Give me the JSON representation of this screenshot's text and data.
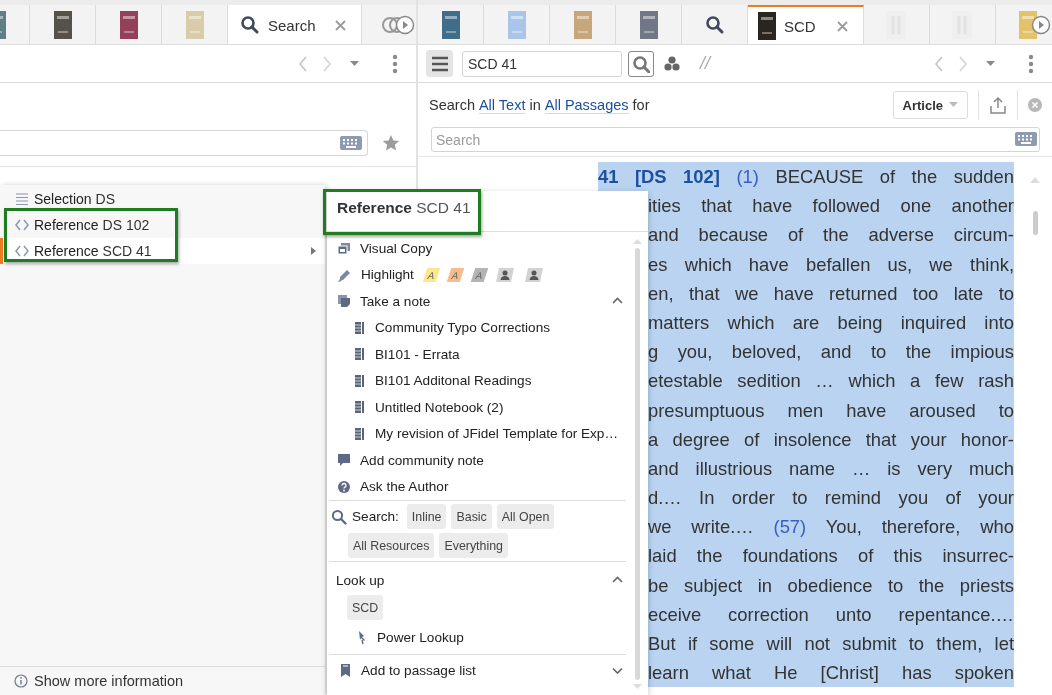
{
  "left_pane": {
    "focused": false,
    "tabs": [
      {
        "kind": "book",
        "color": "#5f7f86",
        "selected": false
      },
      {
        "kind": "book",
        "color": "#57514b",
        "selected": false
      },
      {
        "kind": "book",
        "color": "#94405a",
        "selected": false
      },
      {
        "kind": "book",
        "color": "#d9ccaa",
        "selected": false
      },
      {
        "kind": "search",
        "label": "Search",
        "selected": true
      },
      {
        "kind": "app",
        "selected": false
      }
    ],
    "context_menu": {
      "items": [
        {
          "kind": "selection",
          "label": "Selection",
          "detail": "DS",
          "selected": false,
          "submenu": false,
          "annotated": false
        },
        {
          "kind": "reference",
          "label": "Reference",
          "detail": "DS 102",
          "selected": false,
          "submenu": false,
          "annotated": true
        },
        {
          "kind": "reference",
          "label": "Reference",
          "detail": "SCD 41",
          "selected": true,
          "submenu": true,
          "annotated": true
        }
      ],
      "footer": "Show more information"
    }
  },
  "right_pane": {
    "focused": true,
    "tabs": [
      {
        "kind": "book",
        "color": "#3f6d8a",
        "selected": false
      },
      {
        "kind": "book",
        "color": "#a9c6ea",
        "selected": false
      },
      {
        "kind": "book",
        "color": "#c6a67a",
        "selected": false
      },
      {
        "kind": "book",
        "color": "#717784",
        "selected": false
      },
      {
        "kind": "search",
        "selected": false
      },
      {
        "kind": "book",
        "color": "#2b2520",
        "label": "SCD",
        "selected": true
      },
      {
        "kind": "placeholder_book",
        "selected": false
      },
      {
        "kind": "placeholder_book",
        "selected": false
      },
      {
        "kind": "book",
        "color": "#e2c36c",
        "selected": false
      }
    ],
    "toolbar": {
      "reference": "SCD 41",
      "parallel": "//"
    },
    "search_bar": {
      "query": [
        {
          "kind": "text",
          "text": "Search"
        },
        {
          "kind": "link",
          "text": "All Text"
        },
        {
          "kind": "text",
          "text": "in"
        },
        {
          "kind": "link",
          "text": "All Passages"
        },
        {
          "kind": "text",
          "text": "for"
        }
      ],
      "type_button": "Article",
      "placeholder": "Search"
    },
    "document": {
      "lines": [
        [
          {
            "kind": "ref",
            "text": "41 [DS 102]"
          },
          {
            "kind": "num",
            "text": "(1)"
          },
          {
            "kind": "text",
            "text": "BECAUSE of the sudden"
          }
        ],
        [
          {
            "kind": "text",
            "text": "ities that have followed one another"
          }
        ],
        [
          {
            "kind": "text",
            "text": "and because of the adverse circum-"
          }
        ],
        [
          {
            "kind": "text",
            "text": "es which have befallen us, we think,"
          }
        ],
        [
          {
            "kind": "text",
            "text": "en, that we have returned too late to"
          }
        ],
        [
          {
            "kind": "text",
            "text": "matters which are being inquired into"
          }
        ],
        [
          {
            "kind": "text",
            "text": "g you, beloved, and to the impious"
          }
        ],
        [
          {
            "kind": "text",
            "text": "etestable sedition … which a few rash"
          }
        ],
        [
          {
            "kind": "text",
            "text": "presumptuous men have aroused to"
          }
        ],
        [
          {
            "kind": "text",
            "text": "a degree of insolence that your honor-"
          }
        ],
        [
          {
            "kind": "text",
            "text": "and illustrious name … is very much"
          }
        ],
        [
          {
            "kind": "text",
            "text": "d.… In order to remind you of your"
          }
        ],
        [
          {
            "kind": "text",
            "text": "we write.…"
          },
          {
            "kind": "num",
            "text": "(57)"
          },
          {
            "kind": "text",
            "text": "You, therefore, who"
          }
        ],
        [
          {
            "kind": "text",
            "text": "laid the foundations of this insurrec-"
          }
        ],
        [
          {
            "kind": "text",
            "text": "be subject in obedience to the priests"
          }
        ],
        [
          {
            "kind": "text",
            "text": "eceive correction unto repentance.…"
          }
        ],
        [
          {
            "kind": "text",
            "text": "But if some will not submit to them, let"
          }
        ],
        [
          {
            "kind": "text",
            "text": "learn what He [Christ] has spoken"
          }
        ]
      ]
    }
  },
  "popup": {
    "title": "Reference",
    "title_detail": "SCD 41",
    "annotated": true,
    "items": [
      {
        "kind": "visual_copy",
        "label": "Visual Copy"
      },
      {
        "kind": "highlight",
        "label": "Highlight",
        "swatches": [
          {
            "kind": "letter",
            "text": "A",
            "color": "#fde68c"
          },
          {
            "kind": "letter",
            "text": "A",
            "color": "#f8bc8c"
          },
          {
            "kind": "letter",
            "text": "A",
            "color": "#b4b4b4"
          },
          {
            "kind": "person",
            "color": "#d2d2d2"
          },
          {
            "kind": "person",
            "color": "#d2d2d2"
          }
        ]
      },
      {
        "kind": "note",
        "label": "Take a note",
        "expanded": true,
        "children": [
          {
            "label": "Community Typo Corrections"
          },
          {
            "label": "BI101 - Errata"
          },
          {
            "label": "BI101 Additonal Readings"
          },
          {
            "label": "Untitled Notebook (2)"
          },
          {
            "label": "My revision of JFidel Template for Exp…"
          }
        ]
      },
      {
        "kind": "community_note",
        "label": "Add community note"
      },
      {
        "kind": "ask",
        "label": "Ask the Author"
      },
      {
        "kind": "search",
        "label": "Search:",
        "buttons": [
          "Inline",
          "Basic",
          "All Open",
          "All Resources",
          "Everything"
        ]
      },
      {
        "kind": "lookup",
        "label": "Look up",
        "expanded": true,
        "buttons": [
          "SCD"
        ],
        "children": [
          {
            "label": "Power Lookup"
          }
        ]
      },
      {
        "kind": "passage_list",
        "label": "Add to passage list",
        "expanded": false
      }
    ]
  }
}
